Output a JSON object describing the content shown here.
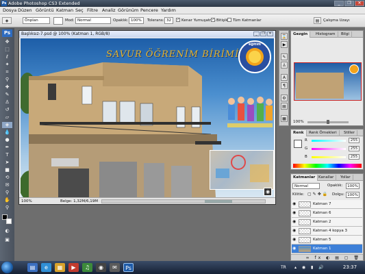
{
  "app": {
    "title": "Adobe Photoshop CS3 Extended",
    "logo_text": "Ps",
    "window_buttons": [
      "_",
      "❐",
      "✕"
    ]
  },
  "menu": [
    "Dosya",
    "Düzen",
    "Görüntü",
    "Katman",
    "Seç",
    "Filtre",
    "Analiz",
    "Görünüm",
    "Pencere",
    "Yardım"
  ],
  "options_bar": {
    "fill_source": "Önplan",
    "mode_label": "Mod:",
    "mode_value": "Normal",
    "opacity_label": "Opaklık:",
    "opacity_value": "100%",
    "tolerance_label": "Tolerans:",
    "tolerance_value": "32",
    "antialias_label": "Kenar Yumuşatma",
    "contiguous_label": "Bitişik",
    "all_layers_label": "Tüm Katmanlar",
    "workspace_label": "Çalışma Uzayı"
  },
  "document": {
    "title": "Başlıksız-7.psd @ 100% (Katman 1, RGB/8)",
    "banner_text": "SAVUR ÖĞRENİM BİRİMİ",
    "logo_ring_text": "eğitim",
    "zoom": "100%",
    "doc_size": "Belge: 1,32M/6,19M"
  },
  "navigator": {
    "tabs": [
      "Gezgin",
      "Histogram",
      "Bilgi"
    ],
    "zoom": "100%"
  },
  "color_panel": {
    "tabs": [
      "Renk",
      "Renk Örnekleri",
      "Stiller"
    ],
    "channels": [
      {
        "label": "R",
        "value": "255"
      },
      {
        "label": "G",
        "value": "255"
      },
      {
        "label": "B",
        "value": "255"
      }
    ]
  },
  "layers_panel": {
    "tabs": [
      "Katmanlar",
      "Kanallar",
      "Yollar"
    ],
    "blend_mode": "Normal",
    "opacity_label": "Opaklık:",
    "opacity_value": "100%",
    "lock_label": "Kilitle:",
    "fill_label": "Dolgu:",
    "fill_value": "100%",
    "layers": [
      {
        "name": "Katman 7",
        "selected": false
      },
      {
        "name": "Katman 6",
        "selected": false
      },
      {
        "name": "Katman 2",
        "selected": false
      },
      {
        "name": "Katman 4 kopya 3",
        "selected": false
      },
      {
        "name": "Katman 5",
        "selected": false
      },
      {
        "name": "Katman 1",
        "selected": true
      }
    ]
  },
  "taskbar": {
    "tray_lang": "TR",
    "clock": "23:37"
  },
  "colors": {
    "accent": "#3c7fd8",
    "logo_orange": "#f3a31b",
    "logo_blue": "#2a4fa0"
  }
}
